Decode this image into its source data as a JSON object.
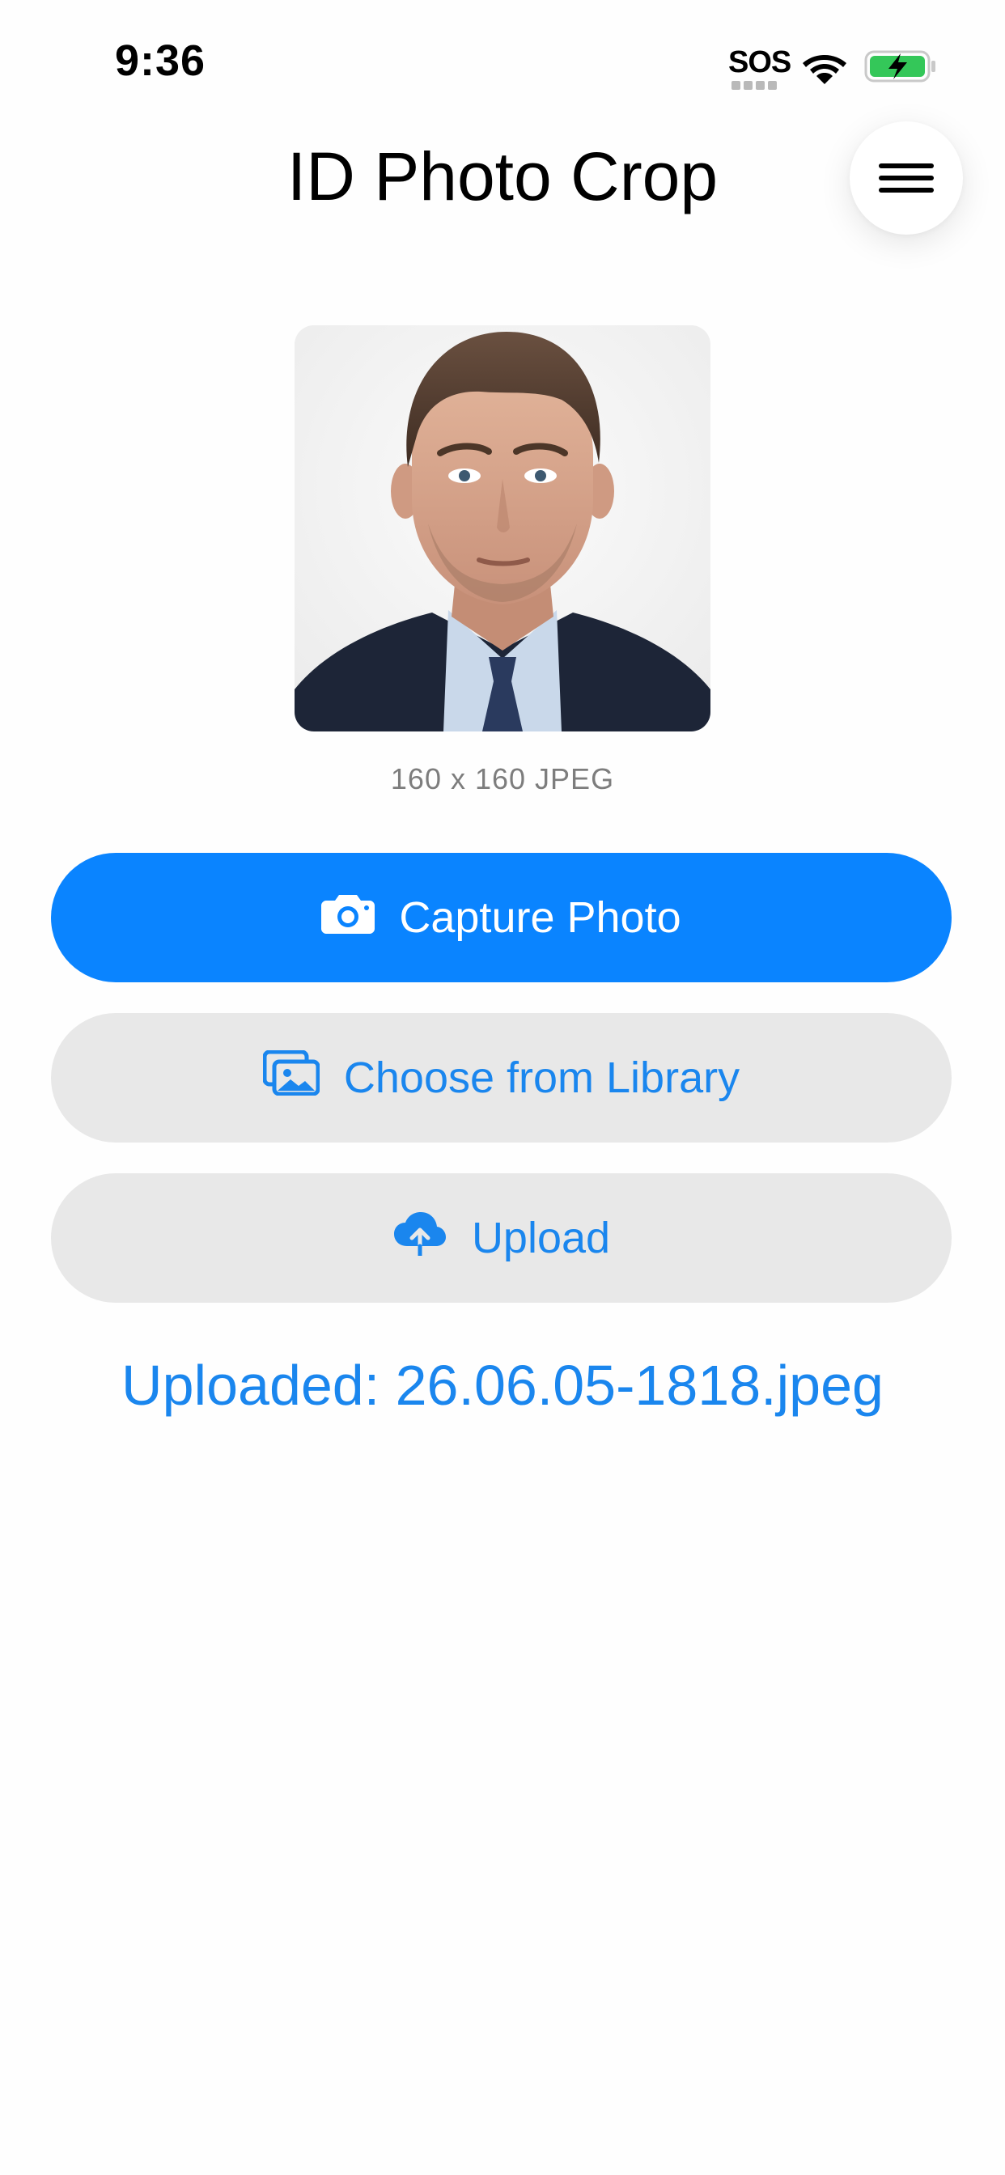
{
  "status_bar": {
    "time": "9:36",
    "sos": "SOS",
    "wifi_icon": "wifi-icon",
    "battery_icon": "battery-charging-icon",
    "battery_color": "#34c759"
  },
  "header": {
    "title": "ID Photo Crop",
    "menu_icon": "hamburger-menu-icon"
  },
  "photo": {
    "caption": "160 x 160 JPEG"
  },
  "actions": {
    "capture_label": "Capture Photo",
    "capture_icon": "camera-icon",
    "library_label": "Choose from Library",
    "library_icon": "photo-library-icon",
    "upload_label": "Upload",
    "upload_icon": "cloud-upload-icon"
  },
  "status": {
    "uploaded_text": "Uploaded: 26.06.05-1818.jpeg"
  },
  "colors": {
    "accent": "#0a84ff",
    "secondary_button_bg": "#e8e8e8",
    "link_text": "#1a86ee"
  }
}
